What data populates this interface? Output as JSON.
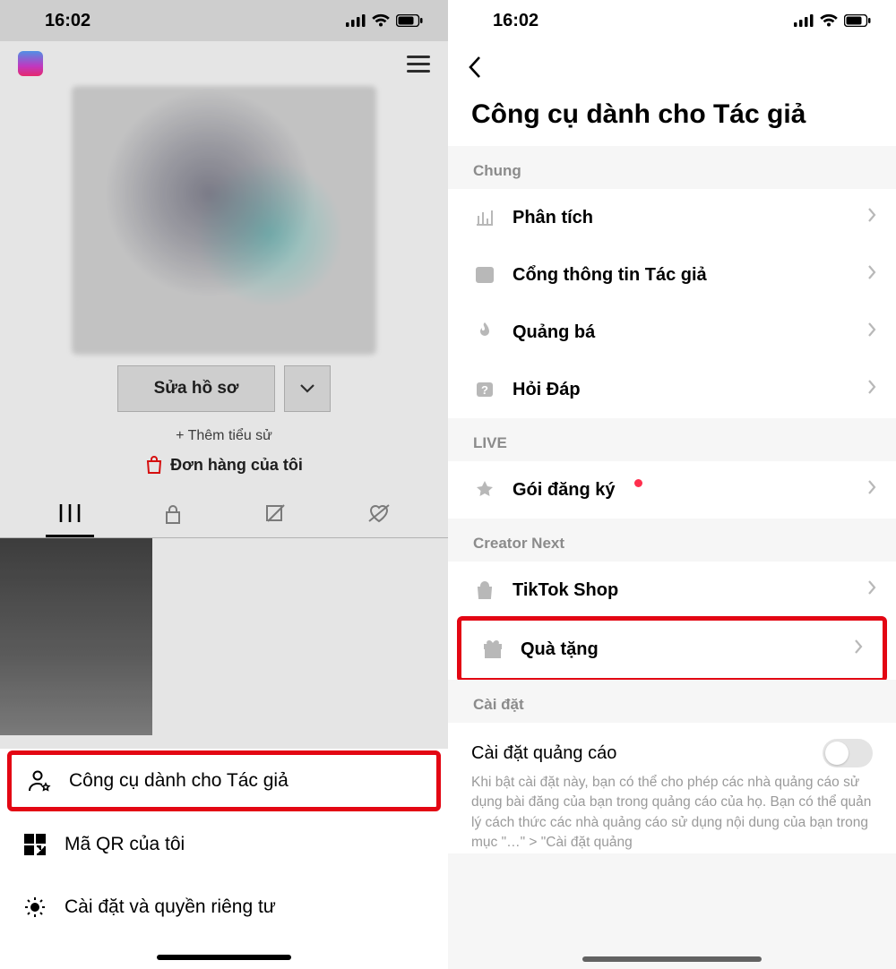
{
  "statusbar": {
    "time": "16:02"
  },
  "left": {
    "edit_profile": "Sửa hồ sơ",
    "add_bio": "+ Thêm tiểu sử",
    "my_orders": "Đơn hàng của tôi",
    "drawer": {
      "creator_tools": "Công cụ dành cho Tác giả",
      "my_qr": "Mã QR của tôi",
      "settings_privacy": "Cài đặt và quyền riêng tư"
    }
  },
  "right": {
    "title": "Công cụ dành cho Tác giả",
    "sections": {
      "general": "Chung",
      "live": "LIVE",
      "creator_next": "Creator Next",
      "settings": "Cài đặt"
    },
    "items": {
      "analytics": "Phân tích",
      "creator_portal": "Cổng thông tin Tác giả",
      "promote": "Quảng bá",
      "qa": "Hỏi Đáp",
      "subscription": "Gói đăng ký",
      "tiktok_shop": "TikTok Shop",
      "gifts": "Quà tặng"
    },
    "ad_settings": {
      "title": "Cài đặt quảng cáo",
      "desc": "Khi bật cài đặt này, bạn có thể cho phép các nhà quảng cáo sử dụng bài đăng của bạn trong quảng cáo của họ. Bạn có thể quản lý cách thức các nhà quảng cáo sử dụng nội dung của bạn trong mục \"…\" > \"Cài đặt quảng"
    }
  }
}
